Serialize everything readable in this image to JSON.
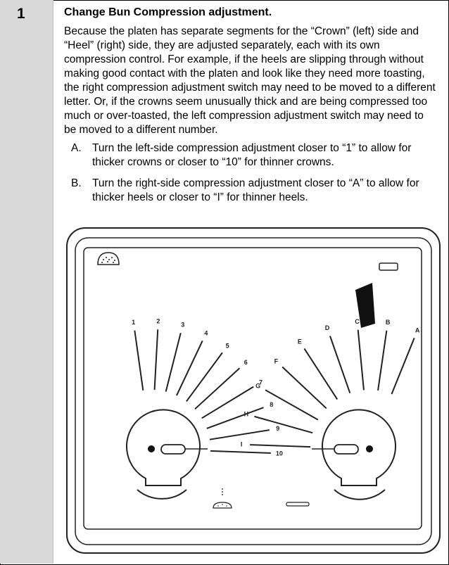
{
  "step": {
    "number": "1"
  },
  "heading": "Change Bun Compression adjustment.",
  "paragraph": "Because the platen has separate segments for the “Crown” (left) side and “Heel” (right) side, they are adjusted separately, each with its own compression control. For example, if the heels are slipping through without making good contact with the platen and look like they need more toasting, the right compression adjustment switch may need to be moved to a different letter. Or, if the crowns seem unusually thick and are being compressed too much or over-toasted, the left compression adjustment switch may need to be moved to a different number.",
  "items": [
    {
      "letter": "A.",
      "text": "Turn the left-side compression adjustment closer to “1” to allow for thicker crowns or closer to “10” for thinner crowns."
    },
    {
      "letter": "B.",
      "text": "Turn the right-side compression adjustment closer to “A” to allow for thicker heels or closer to “I” for thinner heels."
    }
  ],
  "diagram": {
    "left_scale": [
      "1",
      "2",
      "3",
      "4",
      "5",
      "6",
      "7",
      "8",
      "9",
      "10"
    ],
    "right_scale": [
      "A",
      "B",
      "C",
      "D",
      "E",
      "F",
      "G",
      "H",
      "I"
    ]
  }
}
